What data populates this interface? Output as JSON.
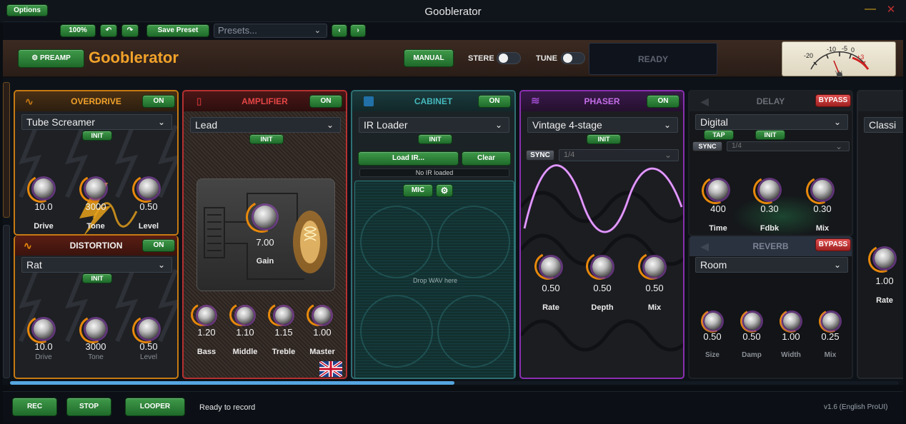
{
  "window": {
    "title": "Gooblerator",
    "options_label": "Options",
    "minimize_glyph": "—",
    "close_glyph": "✕"
  },
  "toolbar": {
    "zoom": "100%",
    "undo_glyph": "↶",
    "redo_glyph": "↷",
    "save_preset": "Save Preset",
    "presets_placeholder": "Presets...",
    "prev_glyph": "‹",
    "next_glyph": "›"
  },
  "header": {
    "preamp_label": "PREAMP",
    "brand": "Gooblerator",
    "manual_label": "MANUAL",
    "stereo_label": "STERE",
    "stereo_on": false,
    "tune_label": "TUNE",
    "tune_on": false,
    "status_display": "READY",
    "vu_meter": {
      "ticks": [
        "-20",
        "-10",
        "-5",
        "0",
        "+3"
      ],
      "unit": "VU"
    }
  },
  "modules": {
    "overdrive": {
      "title": "OVERDRIVE",
      "state": "ON",
      "model": "Tube Screamer",
      "init": "INIT",
      "knobs": [
        {
          "label": "Drive",
          "value": "10.0"
        },
        {
          "label": "Tone",
          "value": "3000"
        },
        {
          "label": "Level",
          "value": "0.50"
        }
      ]
    },
    "distortion": {
      "title": "DISTORTION",
      "state": "ON",
      "model": "Rat",
      "init": "INIT",
      "knobs": [
        {
          "label": "Drive",
          "value": "10.0"
        },
        {
          "label": "Tone",
          "value": "3000"
        },
        {
          "label": "Level",
          "value": "0.50"
        }
      ]
    },
    "amplifier": {
      "title": "AMPLIFIER",
      "state": "ON",
      "model": "Lead",
      "init": "INIT",
      "gain": {
        "label": "Gain",
        "value": "7.00"
      },
      "knobs": [
        {
          "label": "Bass",
          "value": "1.20"
        },
        {
          "label": "Middle",
          "value": "1.10"
        },
        {
          "label": "Treble",
          "value": "1.15"
        },
        {
          "label": "Master",
          "value": "1.00"
        }
      ]
    },
    "cabinet": {
      "title": "CABINET",
      "state": "ON",
      "model": "IR Loader",
      "init": "INIT",
      "load_ir": "Load IR...",
      "clear": "Clear",
      "ir_status": "No IR loaded",
      "mic": "MIC",
      "drop_hint": "Drop WAV here"
    },
    "phaser": {
      "title": "PHASER",
      "state": "ON",
      "model": "Vintage 4-stage",
      "init": "INIT",
      "sync": "SYNC",
      "division": "1/4",
      "knobs": [
        {
          "label": "Rate",
          "value": "0.50"
        },
        {
          "label": "Depth",
          "value": "0.50"
        },
        {
          "label": "Mix",
          "value": "0.50"
        }
      ]
    },
    "delay": {
      "title": "DELAY",
      "state": "BYPASS",
      "model": "Digital",
      "tap": "TAP",
      "init": "INIT",
      "sync": "SYNC",
      "division": "1/4",
      "knobs": [
        {
          "label": "Time",
          "value": "400"
        },
        {
          "label": "Fdbk",
          "value": "0.30"
        },
        {
          "label": "Mix",
          "value": "0.30"
        }
      ]
    },
    "reverb": {
      "title": "REVERB",
      "state": "BYPASS",
      "model": "Room",
      "knobs": [
        {
          "label": "Size",
          "value": "0.50"
        },
        {
          "label": "Damp",
          "value": "0.50"
        },
        {
          "label": "Width",
          "value": "1.00"
        },
        {
          "label": "Mix",
          "value": "0.25"
        }
      ]
    },
    "partial": {
      "model": "Classi",
      "knob": {
        "label": "Rate",
        "value": "1.00"
      }
    }
  },
  "rack_scroll": 0.5,
  "bottom": {
    "rec": "REC",
    "stop": "STOP",
    "looper": "LOOPER",
    "status": "Ready to record",
    "version": "v1.6 (English ProUI)"
  },
  "colors": {
    "accent_orange": "#f2a22a",
    "overdrive": "#e8890c",
    "amplifier": "#d03a3a",
    "cabinet": "#3aa8a8",
    "phaser": "#a040c8",
    "on_green": "#2f8a3a",
    "bypass_red": "#c03030"
  }
}
